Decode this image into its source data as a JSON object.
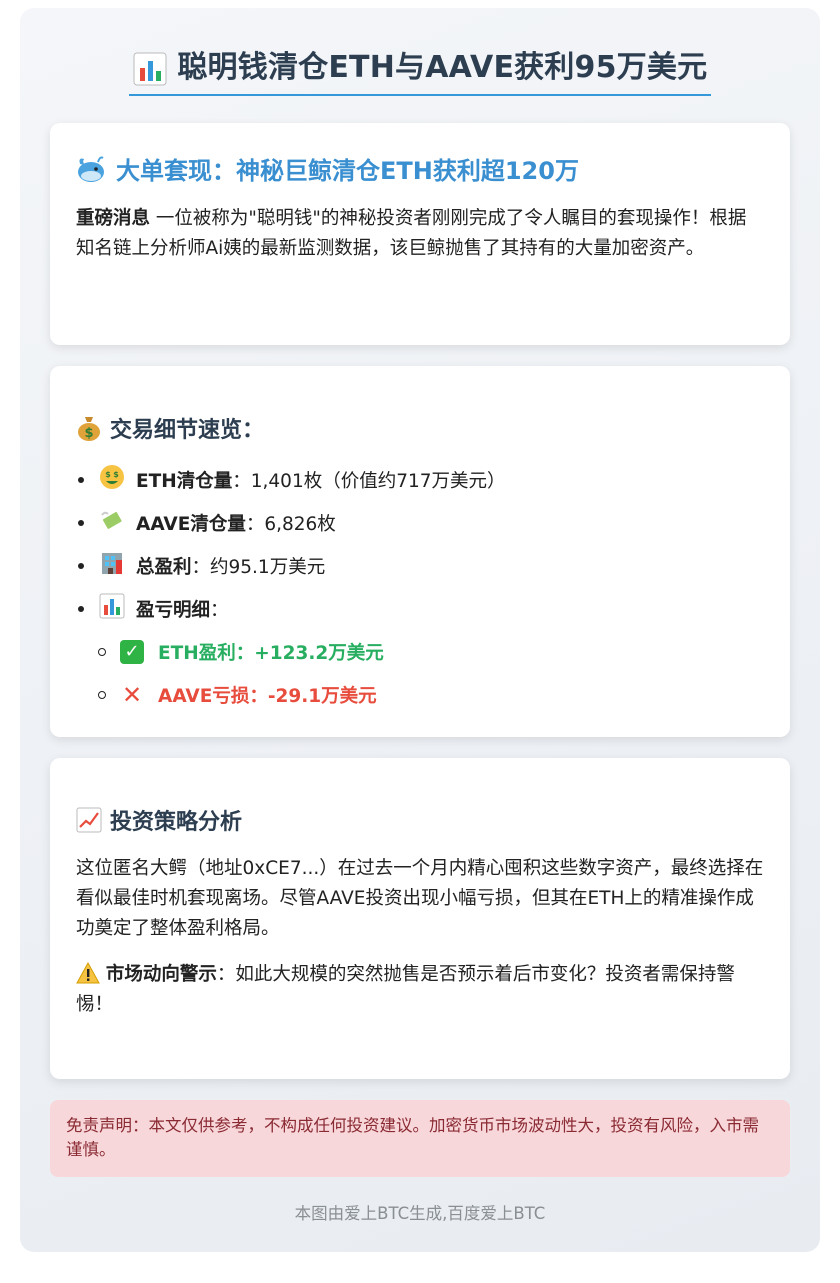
{
  "title": "聪明钱清仓ETH与AAVE获利95万美元",
  "card1": {
    "heading": "大单套现：神秘巨鲸清仓ETH获利超120万",
    "lead_bold": "重磅消息",
    "lead_text": " 一位被称为\"聪明钱\"的神秘投资者刚刚完成了令人瞩目的套现操作！根据知名链上分析师Ai姨的最新监测数据，该巨鲸抛售了其持有的大量加密资产。"
  },
  "card2": {
    "heading": "交易细节速览：",
    "items": [
      {
        "icon": "money-face-icon",
        "label": "ETH清仓量",
        "value": "：1,401枚（价值约717万美元）"
      },
      {
        "icon": "money-wings-icon",
        "label": "AAVE清仓量",
        "value": "：6,826枚"
      },
      {
        "icon": "bank-icon",
        "label": "总盈利",
        "value": "：约95.1万美元"
      },
      {
        "icon": "bar-chart-icon",
        "label": "盈亏明细",
        "value": "："
      }
    ],
    "sub_items": [
      {
        "icon": "check-icon",
        "text": "ETH盈利：+123.2万美元",
        "color": "#27ae60"
      },
      {
        "icon": "cross-icon",
        "text": "AAVE亏损：-29.1万美元",
        "color": "#e74c3c"
      }
    ]
  },
  "card3": {
    "heading": "投资策略分析",
    "paragraph": "这位匿名大鳄（地址0xCE7...）在过去一个月内精心囤积这些数字资产，最终选择在看似最佳时机套现离场。尽管AAVE投资出现小幅亏损，但其在ETH上的精准操作成功奠定了整体盈利格局。",
    "warning_bold": "市场动向警示",
    "warning_text": "：如此大规模的突然抛售是否预示着后市变化？投资者需保持警惕！"
  },
  "disclaimer": "免责声明：本文仅供参考，不构成任何投资建议。加密货币市场波动性大，投资有风险，入市需谨慎。",
  "footer": "本图由爱上BTC生成,百度爱上BTC",
  "colors": {
    "accent": "#3498db",
    "heading_blue": "#3a8fd1",
    "profit": "#27ae60",
    "loss": "#e74c3c",
    "disclaimer_bg": "#f8d7da"
  }
}
